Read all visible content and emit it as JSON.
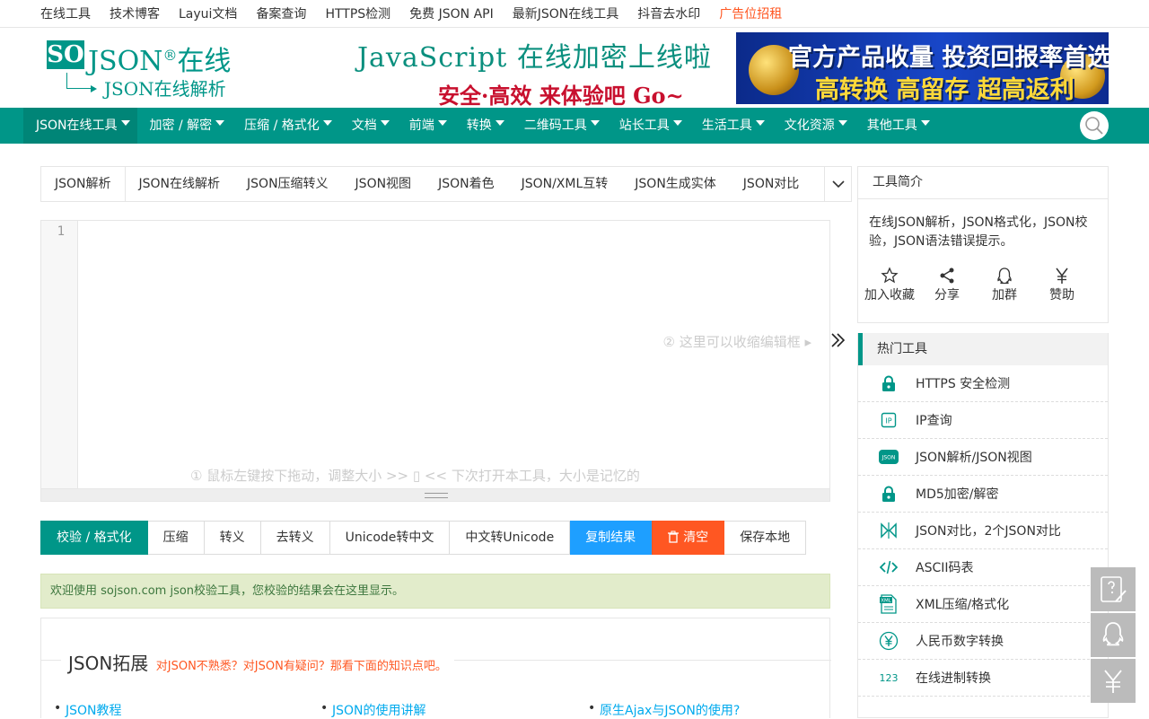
{
  "topbar": {
    "links": [
      "在线工具",
      "技术博客",
      "Layui文档",
      "备案查询",
      "HTTPS检测",
      "免费 JSON API",
      "最新JSON在线工具",
      "抖音去水印"
    ],
    "ad": "广告位招租"
  },
  "header": {
    "logo_so": "SO",
    "logo_json": "JSON",
    "logo_reg": "®",
    "logo_zx": "在线",
    "logo_sub": "JSON在线解析",
    "promo_line1": "JavaScript 在线加密上线啦",
    "promo_line2": "安全·高效 来体验吧 Go~",
    "banner_line1": "官方产品收量 投资回报率首选",
    "banner_line2": "高转换 高留存 超高返利"
  },
  "nav": {
    "items": [
      "JSON在线工具",
      "加密 / 解密",
      "压缩 / 格式化",
      "文档",
      "前端",
      "转换",
      "二维码工具",
      "站长工具",
      "生活工具",
      "文化资源",
      "其他工具"
    ],
    "accent": "#009688"
  },
  "tabs": [
    "JSON解析",
    "JSON在线解析",
    "JSON压缩转义",
    "JSON视图",
    "JSON着色",
    "JSON/XML互转",
    "JSON生成实体",
    "JSON对比"
  ],
  "editor": {
    "line_number": "1",
    "hint_collapse": "② 这里可以收缩编辑框 ▸",
    "hint_resize": "① 鼠标左键按下拖动，调整大小 >> ▯ << 下次打开本工具，大小是记忆的"
  },
  "buttons": {
    "validate": "校验 / 格式化",
    "compress": "压缩",
    "escape": "转义",
    "unescape": "去转义",
    "unicode_to_cn": "Unicode转中文",
    "cn_to_unicode": "中文转Unicode",
    "copy": "复制结果",
    "clear": "清空",
    "save": "保存本地"
  },
  "result_text": "欢迎使用 sojson.com json校验工具，您校验的结果会在这里显示。",
  "extension": {
    "title": "JSON拓展",
    "subtitle": "对JSON不熟悉？对JSON有疑问？那看下面的知识点吧。",
    "links": [
      "JSON教程",
      "JSON的使用讲解",
      "原生Ajax与JSON的使用?"
    ]
  },
  "intro": {
    "title": "工具简介",
    "desc": "在线JSON解析，JSON格式化，JSON校验，JSON语法错误提示。",
    "actions": [
      "加入收藏",
      "分享",
      "加群",
      "赞助"
    ]
  },
  "hot": {
    "title": "热门工具",
    "items": [
      {
        "label": "HTTPS 安全检测",
        "icon": "lock-icon"
      },
      {
        "label": "IP查询",
        "icon": "ip-icon"
      },
      {
        "label": "JSON解析/JSON视图",
        "icon": "json-icon"
      },
      {
        "label": "MD5加密/解密",
        "icon": "lock-icon"
      },
      {
        "label": "JSON对比，2个JSON对比",
        "icon": "compare-icon"
      },
      {
        "label": "ASCII码表",
        "icon": "code-icon"
      },
      {
        "label": "XML压缩/格式化",
        "icon": "xml-icon"
      },
      {
        "label": "人民币数字转换",
        "icon": "yuan-icon"
      },
      {
        "label": "在线进制转换",
        "icon": "number-icon"
      }
    ],
    "icon_badge_json": "JSON",
    "icon_badge_ip": "IP",
    "icon_badge_xml": "XML",
    "icon_badge_num": "123"
  }
}
